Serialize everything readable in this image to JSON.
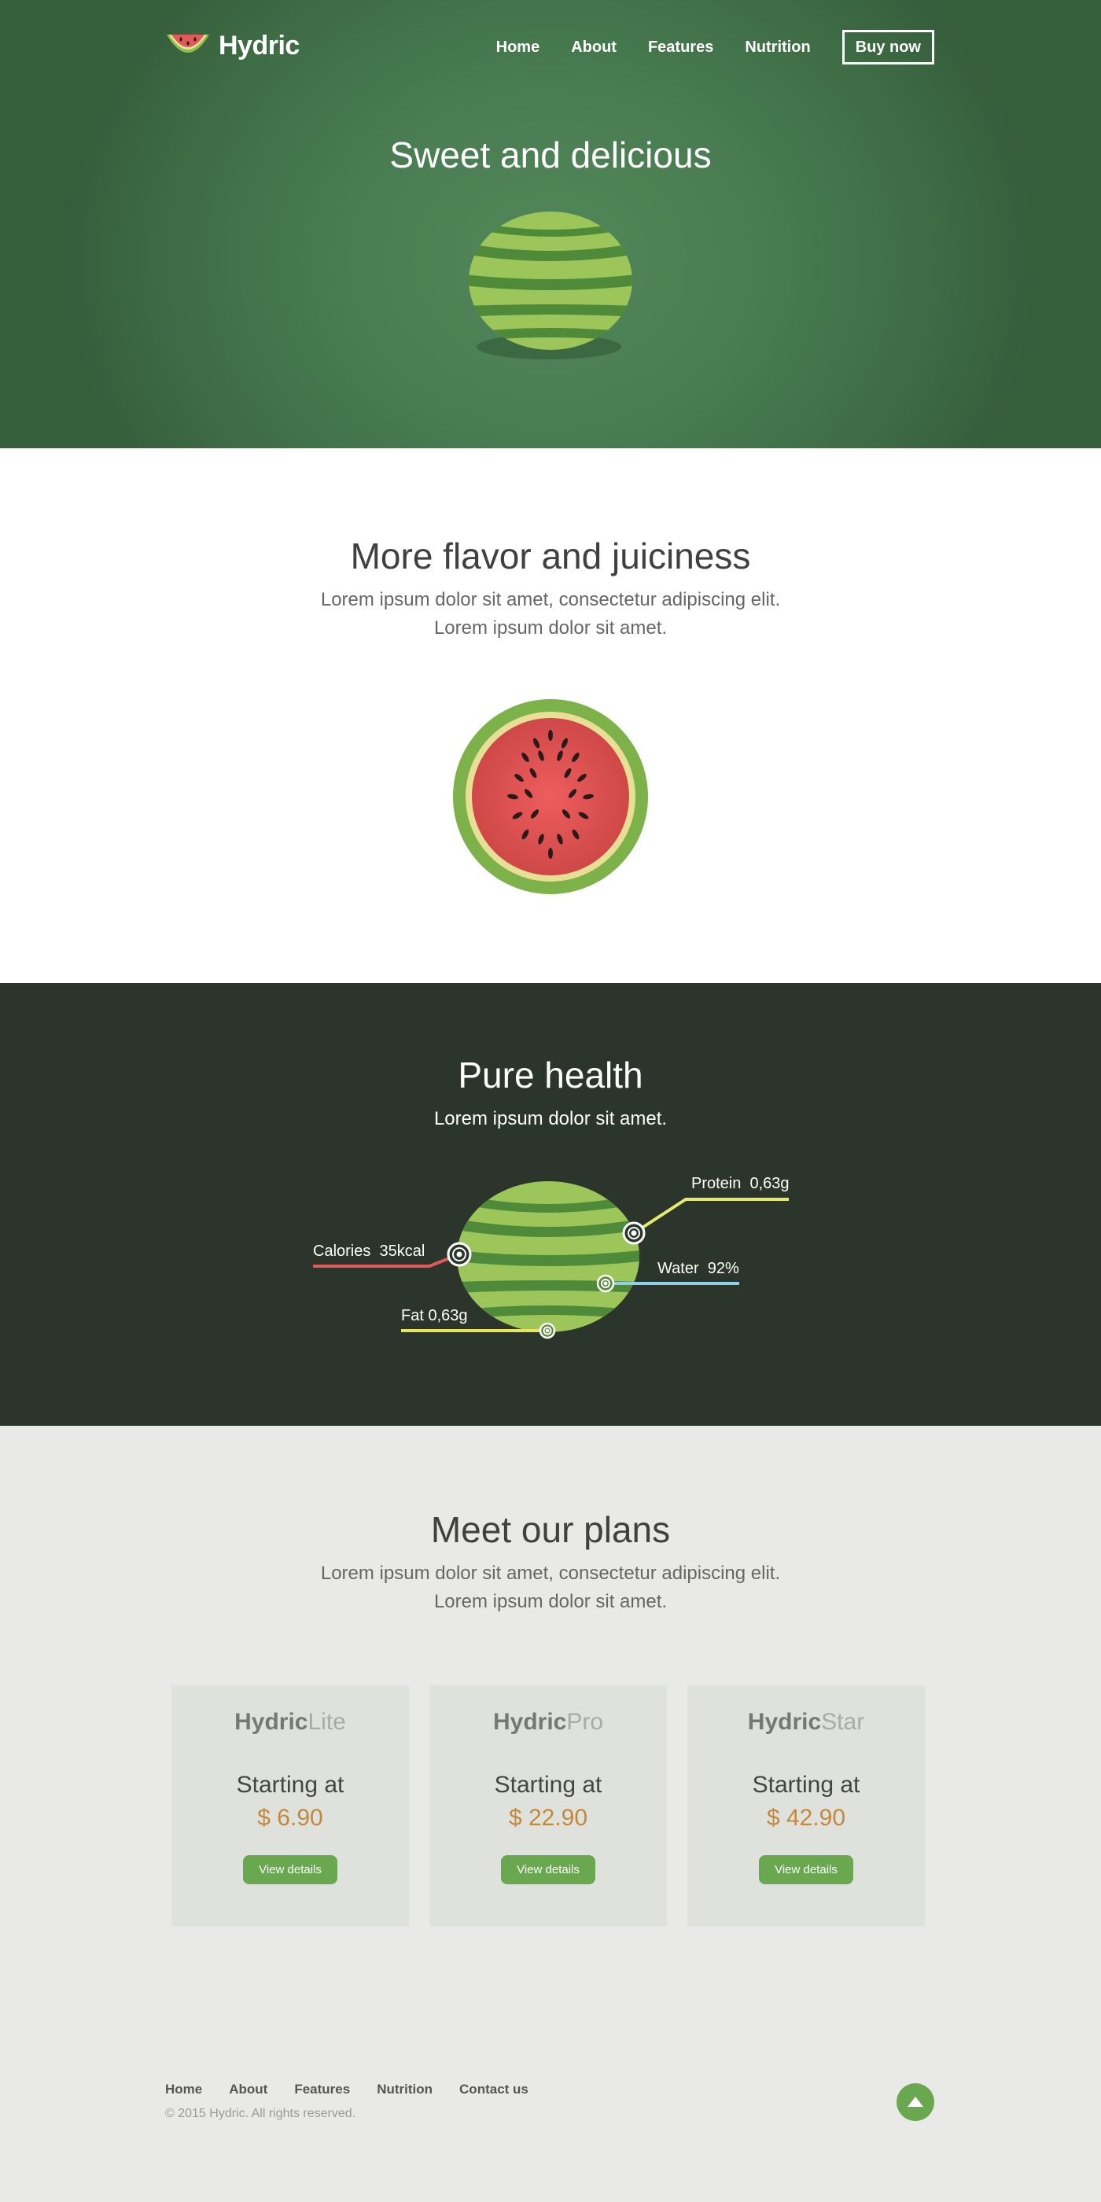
{
  "header": {
    "logo_text": "Hydric",
    "nav": [
      "Home",
      "About",
      "Features",
      "Nutrition"
    ],
    "buy_label": "Buy now"
  },
  "hero": {
    "title": "Sweet and delicious"
  },
  "flavor": {
    "title": "More flavor and juiciness",
    "subtitle_line1": "Lorem ipsum dolor sit amet, consectetur adipiscing elit.",
    "subtitle_line2": "Lorem ipsum dolor sit amet."
  },
  "health": {
    "title": "Pure health",
    "subtitle": "Lorem ipsum dolor sit amet.",
    "nutrients": [
      {
        "name": "Calories",
        "value": "35kcal",
        "color": "#e05a5a"
      },
      {
        "name": "Fat",
        "value": "0,63g",
        "color": "#e6e65a"
      },
      {
        "name": "Protein",
        "value": "0,63g",
        "color": "#e6ea6a"
      },
      {
        "name": "Water",
        "value": "92%",
        "color": "#8fd0e8"
      }
    ]
  },
  "plans": {
    "title": "Meet our plans",
    "subtitle_line1": "Lorem ipsum dolor sit amet, consectetur adipiscing elit.",
    "subtitle_line2": "Lorem ipsum dolor sit amet.",
    "cards": [
      {
        "brand": "Hydric",
        "tier": "Lite",
        "start": "Starting at",
        "price": "$ 6.90",
        "button": "View details"
      },
      {
        "brand": "Hydric",
        "tier": "Pro",
        "start": "Starting at",
        "price": "$ 22.90",
        "button": "View details"
      },
      {
        "brand": "Hydric",
        "tier": "Star",
        "start": "Starting at",
        "price": "$ 42.90",
        "button": "View details"
      }
    ]
  },
  "footer": {
    "links": [
      "Home",
      "About",
      "Features",
      "Nutrition",
      "Contact us"
    ],
    "copyright": "© 2015 Hydric. All rights reserved."
  },
  "colors": {
    "accent_green": "#6aa84f",
    "price_gold": "#c3893b",
    "hero_green": "#4a7e52",
    "health_bg": "#2c352c"
  },
  "icons": {
    "logo": "watermelon-slice-icon",
    "back_to_top": "arrow-up-icon"
  }
}
